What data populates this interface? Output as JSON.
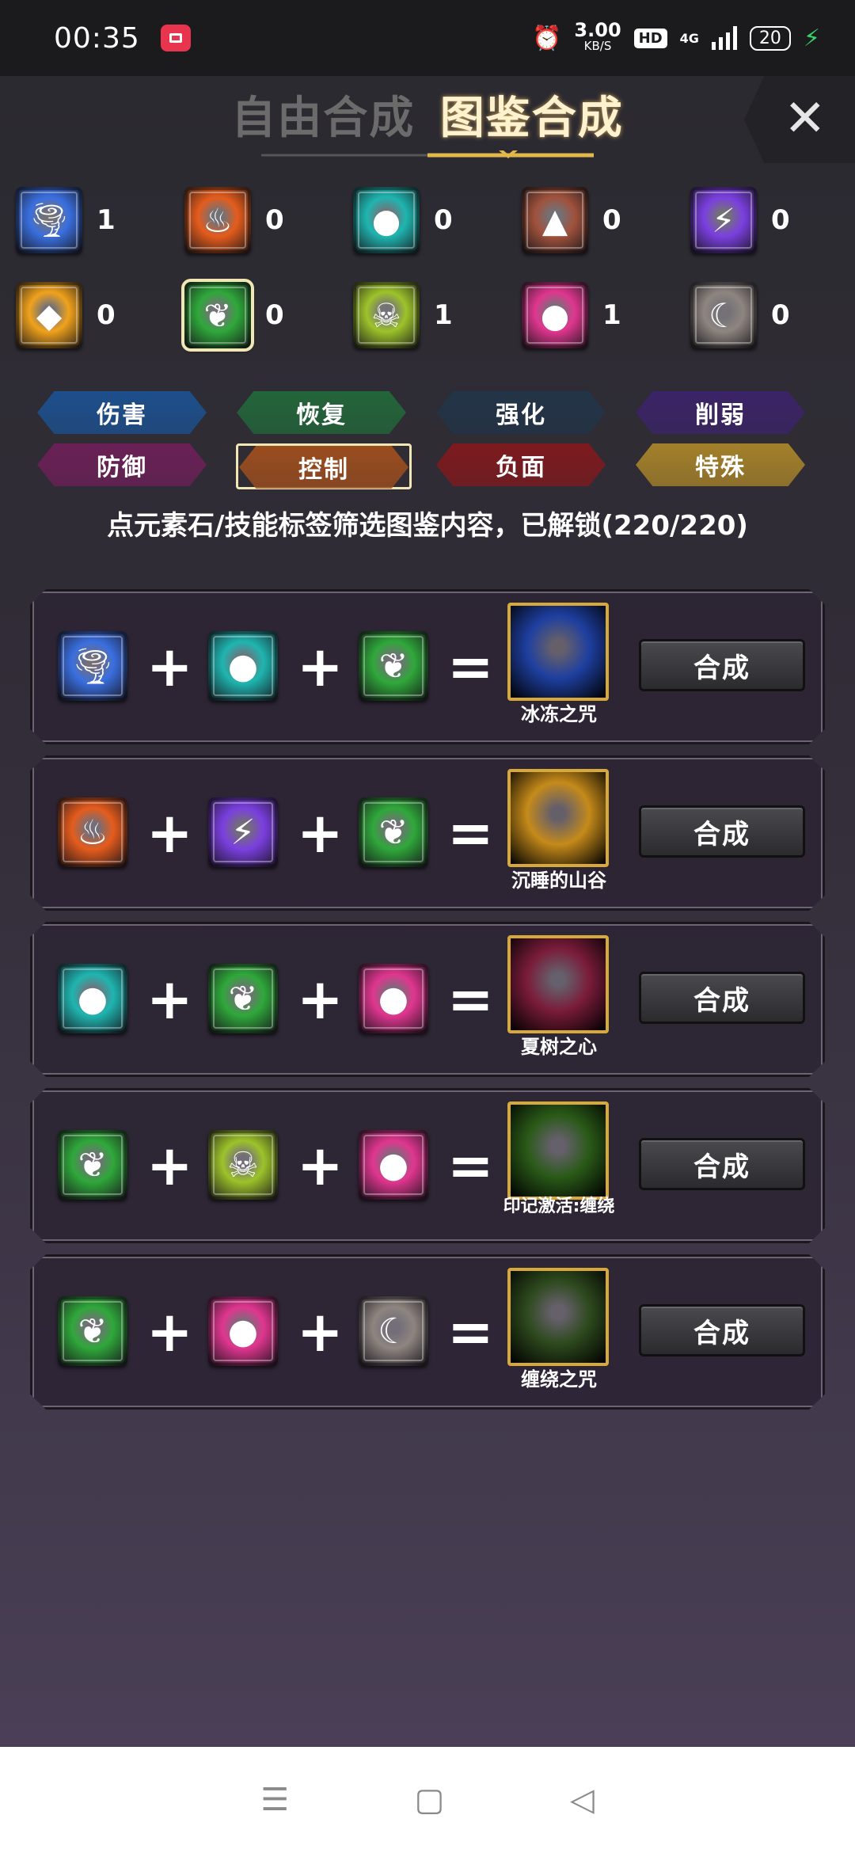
{
  "status_bar": {
    "time": "00:35",
    "net_speed": "3.00",
    "net_unit": "KB/S",
    "hd": "HD",
    "signal": "4G",
    "battery": "20"
  },
  "header": {
    "tab_free": "自由合成",
    "tab_book": "图鉴合成",
    "close": "✕"
  },
  "elements": [
    {
      "name": "wind",
      "count": "1",
      "color": "#3a6fe0",
      "glyph": "🌪"
    },
    {
      "name": "fire",
      "count": "0",
      "color": "#e55c1c",
      "glyph": "♨"
    },
    {
      "name": "water",
      "count": "0",
      "color": "#1fb5b0",
      "glyph": "●"
    },
    {
      "name": "earth",
      "count": "0",
      "color": "#a0523c",
      "glyph": "▲"
    },
    {
      "name": "lightning",
      "count": "0",
      "color": "#7b3fe0",
      "glyph": "⚡"
    },
    {
      "name": "light",
      "count": "0",
      "color": "#f0a21c",
      "glyph": "◆"
    },
    {
      "name": "nature",
      "count": "0",
      "color": "#2fa83a",
      "glyph": "❦"
    },
    {
      "name": "poison",
      "count": "1",
      "color": "#9dc32a",
      "glyph": "☠"
    },
    {
      "name": "arcane",
      "count": "1",
      "color": "#e0368f",
      "glyph": "●"
    },
    {
      "name": "shadow",
      "count": "0",
      "color": "#8e8580",
      "glyph": "☾"
    }
  ],
  "filters": [
    {
      "label": "伤害",
      "color": "#1d4f8c"
    },
    {
      "label": "恢复",
      "color": "#23653a"
    },
    {
      "label": "强化",
      "color": "#223447"
    },
    {
      "label": "削弱",
      "color": "#3b2466"
    },
    {
      "label": "防御",
      "color": "#6a2056"
    },
    {
      "label": "控制",
      "color": "#9a4d1e"
    },
    {
      "label": "负面",
      "color": "#7d1a1e"
    },
    {
      "label": "特殊",
      "color": "#a3802a"
    }
  ],
  "hint": "点元素石/技能标签筛选图鉴内容，已解锁(220/220)",
  "recipes": [
    {
      "inputs": [
        "wind",
        "water",
        "nature"
      ],
      "result": "冰冻之咒",
      "result_color": "#1e3fa0",
      "button": "合成"
    },
    {
      "inputs": [
        "fire",
        "lightning",
        "nature"
      ],
      "result": "沉睡的山谷",
      "result_color": "#c58a1a",
      "button": "合成"
    },
    {
      "inputs": [
        "water",
        "nature",
        "arcane"
      ],
      "result": "夏树之心",
      "result_color": "#7a1c3a",
      "button": "合成"
    },
    {
      "inputs": [
        "nature",
        "poison",
        "arcane"
      ],
      "result": "印记激活:缠绕",
      "result_color": "#2a5a18",
      "button": "合成"
    },
    {
      "inputs": [
        "nature",
        "arcane",
        "shadow"
      ],
      "result": "缠绕之咒",
      "result_color": "#2e4a1e",
      "button": "合成"
    }
  ],
  "nav": {
    "menu": "☰",
    "home": "▢",
    "back": "◁"
  }
}
